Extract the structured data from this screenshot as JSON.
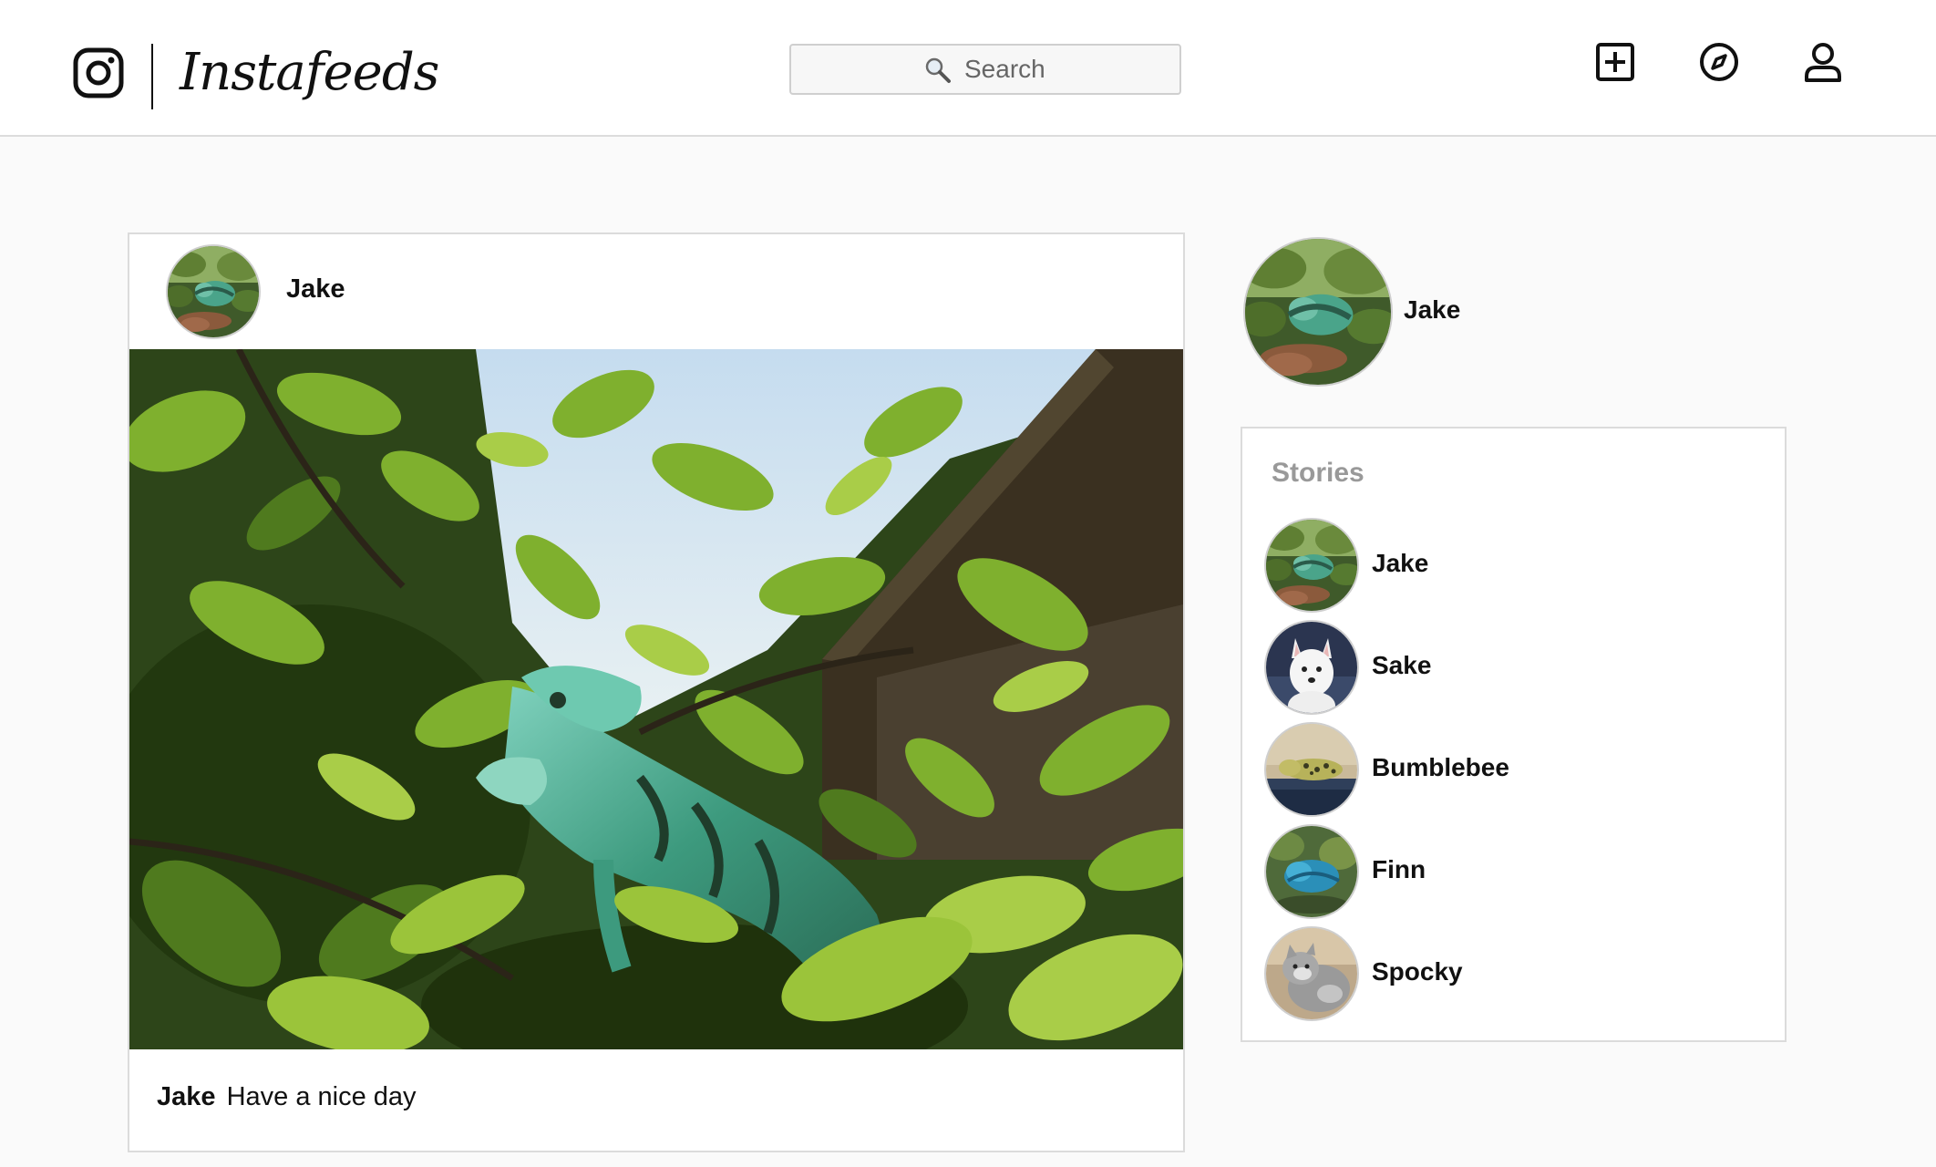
{
  "header": {
    "brand": "Instafeeds",
    "search_placeholder": "Search",
    "icons": [
      "instagram-icon",
      "new-post-icon",
      "explore-icon",
      "profile-icon"
    ]
  },
  "post": {
    "username": "Jake",
    "caption_user": "Jake",
    "caption_text": "Have a nice day"
  },
  "sidebar": {
    "profile_name": "Jake",
    "stories_title": "Stories",
    "stories": [
      {
        "name": "Jake"
      },
      {
        "name": "Sake"
      },
      {
        "name": "Bumblebee"
      },
      {
        "name": "Finn"
      },
      {
        "name": "Spocky"
      }
    ]
  }
}
